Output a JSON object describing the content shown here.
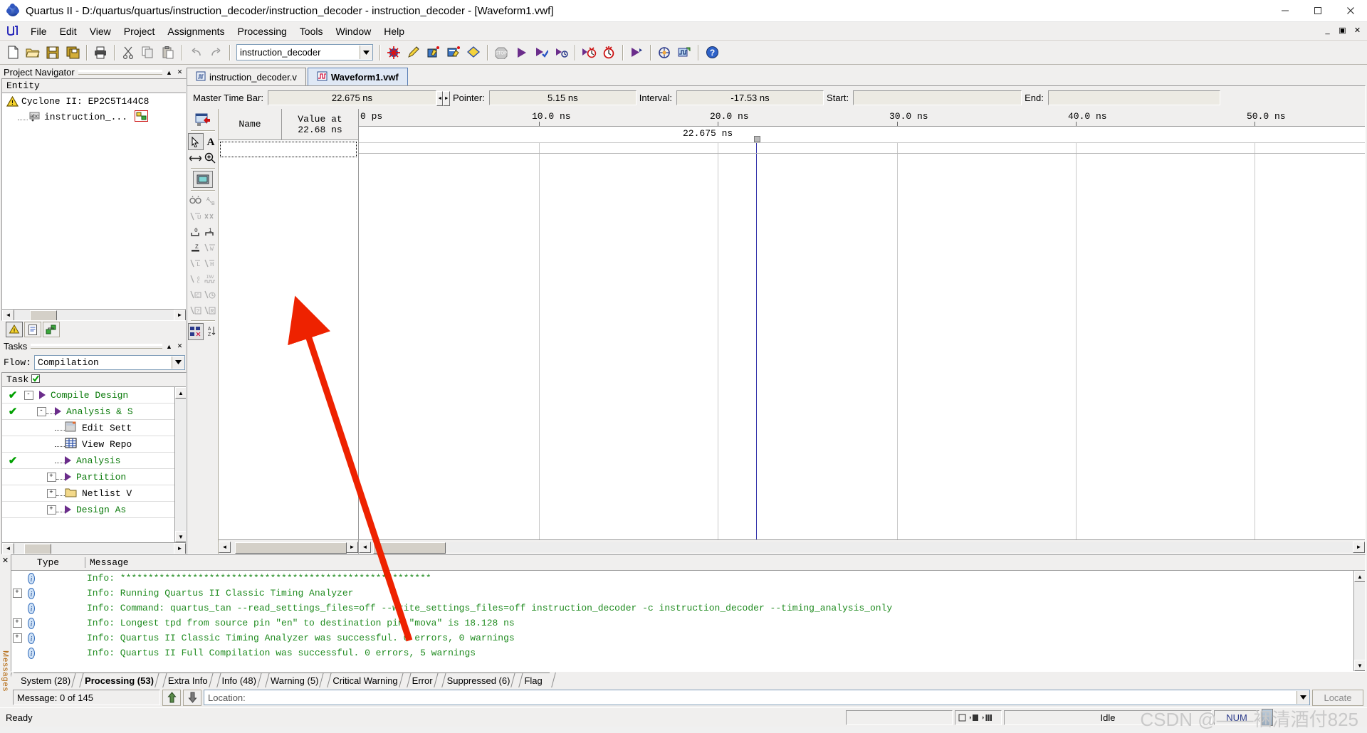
{
  "window": {
    "title": "Quartus II - D:/quartus/quartus/instruction_decoder/instruction_decoder - instruction_decoder - [Waveform1.vwf]",
    "minimize": "minimize-icon",
    "maximize": "maximize-icon",
    "close": "close-icon"
  },
  "menu": {
    "items": [
      "File",
      "Edit",
      "View",
      "Project",
      "Assignments",
      "Processing",
      "Tools",
      "Window",
      "Help"
    ],
    "mdi_minimize": "_",
    "mdi_restore": "▣",
    "mdi_close": "✕"
  },
  "toolbar": {
    "icons": [
      "new-file-icon",
      "open-folder-icon",
      "save-icon",
      "save-all-icon",
      "print-icon",
      "cut-icon",
      "copy-icon",
      "paste-icon",
      "undo-icon",
      "redo-icon"
    ],
    "project_value": "instruction_decoder",
    "right_icons": [
      "compilation-report-icon",
      "pin-planner-icon",
      "assignment-editor-icon",
      "settings-icon",
      "device-icon",
      "stop-icon",
      "start-compilation-icon",
      "start-analysis-synthesis-icon",
      "start-simulation-icon",
      "timing-analyzer-icon",
      "classic-timing-icon",
      "programmer-icon",
      "chip-planner-icon",
      "simulation-waveform-icon",
      "help-icon"
    ]
  },
  "project_navigator": {
    "title": "Project Navigator",
    "column_header": "Entity",
    "rows": [
      {
        "label": "Cyclone II: EP2C5T144C8",
        "icon": "warning-triangle-icon"
      },
      {
        "label": "instruction_...",
        "icon": "abc-icon"
      }
    ],
    "tabs": [
      "hierarchy-tab",
      "files-tab",
      "design-units-tab"
    ]
  },
  "tasks": {
    "title": "Tasks",
    "flow_label": "Flow:",
    "flow_value": "Compilation",
    "column_header": "Task",
    "rows": [
      {
        "label": "Compile Design",
        "check": "✔",
        "expander": "-",
        "icon": "run-arrow-icon",
        "indent": 0
      },
      {
        "label": "Analysis & S",
        "check": "✔",
        "expander": "-",
        "icon": "run-arrow-icon",
        "indent": 1
      },
      {
        "label": "Edit Sett",
        "check": "",
        "expander": "",
        "icon": "settings-page-icon",
        "indent": 2
      },
      {
        "label": "View Repo",
        "check": "",
        "expander": "",
        "icon": "report-table-icon",
        "indent": 2
      },
      {
        "label": "Analysis",
        "check": "✔",
        "expander": "",
        "icon": "run-arrow-icon",
        "indent": 2
      },
      {
        "label": "Partition",
        "check": "",
        "expander": "+",
        "icon": "run-arrow-icon",
        "indent": 2
      },
      {
        "label": "Netlist V",
        "check": "",
        "expander": "+",
        "icon": "folder-icon",
        "indent": 2
      },
      {
        "label": "Design As",
        "check": "",
        "expander": "+",
        "icon": "run-arrow-icon",
        "indent": 2
      }
    ]
  },
  "document_tabs": [
    {
      "label": "instruction_decoder.v",
      "icon": "verilog-file-icon",
      "active": false
    },
    {
      "label": "Waveform1.vwf",
      "icon": "waveform-file-icon",
      "active": true
    }
  ],
  "time_bar": {
    "master_label": "Master Time Bar:",
    "master_value": "22.675 ns",
    "pointer_label": "Pointer:",
    "pointer_value": "5.15 ns",
    "interval_label": "Interval:",
    "interval_value": "-17.53 ns",
    "start_label": "Start:",
    "start_value": "",
    "end_label": "End:",
    "end_value": ""
  },
  "waveform": {
    "toolbar_icons": [
      "insert-node-icon",
      "selection-tool-icon",
      "text-tool-icon",
      "waveform-edit-icon",
      "zoom-tool-icon",
      "full-screen-icon",
      "find-icon",
      "replace-icon",
      "undefined-value-icon",
      "random-value-icon",
      "forcing-low-icon",
      "forcing-high-icon",
      "forcing-unknown-z-icon",
      "weak-value-icon",
      "forcing-low-l-icon",
      "forcing-high-h-icon",
      "count-value-icon",
      "invert-icon",
      "clock-c-icon",
      "arbitrary-value-icon",
      "unknown-value-icon",
      "random-r-icon",
      "grouping-icon",
      "sort-az-icon"
    ],
    "name_column_header": "Name",
    "value_column_header_line1": "Value at",
    "value_column_header_line2": "22.68 ns",
    "cursor_label": "22.675 ns",
    "ruler_ticks": [
      "0 ps",
      "10.0 ns",
      "20.0 ns",
      "30.0 ns",
      "40.0 ns",
      "50.0 ns"
    ]
  },
  "messages": {
    "columns": [
      "Type",
      "Message"
    ],
    "rows": [
      {
        "expandable": false,
        "icon": "info-icon",
        "text": "Info: ********************************************************"
      },
      {
        "expandable": true,
        "icon": "info-icon",
        "text": "Info: Running Quartus II Classic Timing Analyzer"
      },
      {
        "expandable": false,
        "icon": "info-icon",
        "text": "Info: Command: quartus_tan --read_settings_files=off --write_settings_files=off instruction_decoder -c instruction_decoder --timing_analysis_only"
      },
      {
        "expandable": true,
        "icon": "info-icon",
        "text": "Info: Longest tpd from source pin \"en\" to destination pin \"mova\" is 18.128 ns"
      },
      {
        "expandable": true,
        "icon": "info-icon",
        "text": "Info: Quartus II Classic Timing Analyzer was successful. 0 errors, 0 warnings"
      },
      {
        "expandable": false,
        "icon": "info-icon",
        "text": "Info: Quartus II Full Compilation was successful. 0 errors, 5 warnings"
      }
    ],
    "tabs": [
      {
        "label": "System (28)",
        "active": false
      },
      {
        "label": "Processing (53)",
        "active": true
      },
      {
        "label": "Extra Info",
        "active": false
      },
      {
        "label": "Info (48)",
        "active": false
      },
      {
        "label": "Warning (5)",
        "active": false
      },
      {
        "label": "Critical Warning",
        "active": false
      },
      {
        "label": "Error",
        "active": false
      },
      {
        "label": "Suppressed (6)",
        "active": false
      },
      {
        "label": "Flag",
        "active": false
      }
    ],
    "count_text": "Message: 0 of 145",
    "up_icon": "move-up-icon",
    "down_icon": "move-down-icon",
    "location_label": "Location:",
    "locate_button": "Locate",
    "panel_vertical_label": "Messages"
  },
  "status_bar": {
    "ready": "Ready",
    "progress_icon": "compile-stages-icon",
    "state": "Idle",
    "num_lock": "NUM",
    "watermark": "CSDN @——裍清酒付825"
  },
  "colors": {
    "accent": "#3333aa",
    "info_green": "#1f8b1f",
    "check_green": "#00a000",
    "purple": "#6b2d8b",
    "arrow_red": "#ee2200",
    "chrome": "#f0efee"
  }
}
